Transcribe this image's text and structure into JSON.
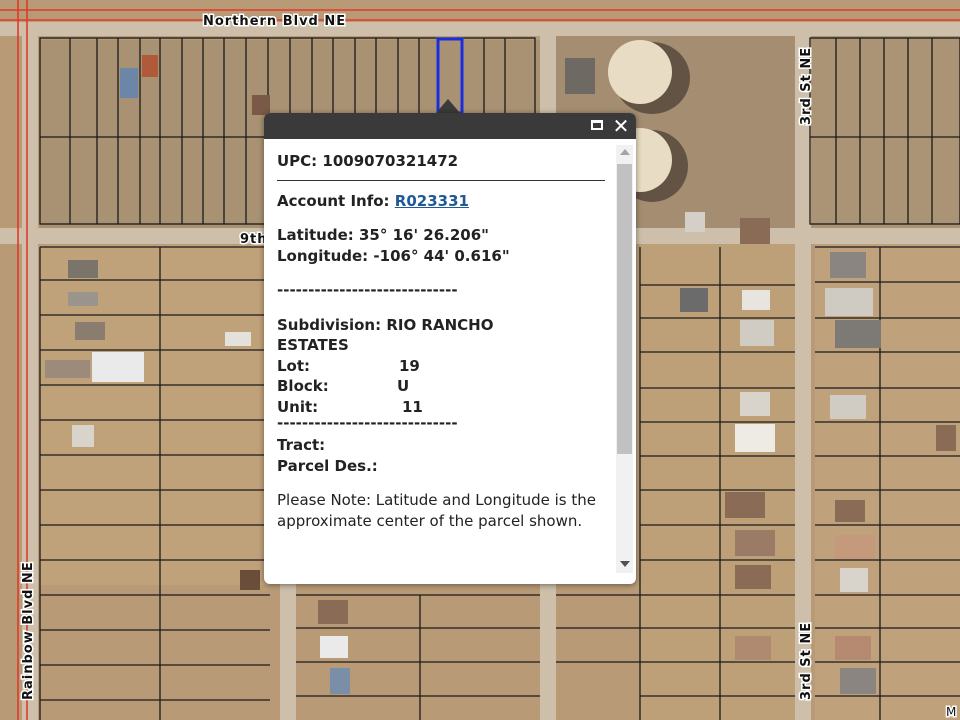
{
  "map": {
    "roads": {
      "northern": "Northern  Blvd  NE",
      "third_st_top": "3rd St NE",
      "third_st_bottom": "3rd St NE",
      "rainbow": "Rainbow  Blvd  NE",
      "ninth": "9th"
    },
    "attribution": "M",
    "colors": {
      "parcel_line": "#1a1a1a",
      "selected_parcel": "#1a2ee0",
      "road_line": "#e03a2a"
    }
  },
  "popup": {
    "upc_label": "UPC:",
    "upc_value": "1009070321472",
    "account_label": "Account Info:",
    "account_value": "R023331",
    "latitude_label": "Latitude:",
    "latitude_value": "35° 16' 26.206\"",
    "longitude_label": "Longitude:",
    "longitude_value": "-106° 44' 0.616\"",
    "divider": "-----------------------------",
    "subdivision_label": "Subdivision:",
    "subdivision_value": "RIO RANCHO ESTATES",
    "lot_label": "Lot:",
    "lot_value": "19",
    "block_label": "Block:",
    "block_value": "U",
    "unit_label": "Unit:",
    "unit_value": "11",
    "tract_label": "Tract:",
    "parcel_des_label": "Parcel Des.:",
    "note": "Please Note: Latitude and Longitude is the approximate center of the parcel shown.",
    "maximize_icon": "maximize-icon",
    "close_icon": "close-icon",
    "close_glyph": "✕"
  }
}
